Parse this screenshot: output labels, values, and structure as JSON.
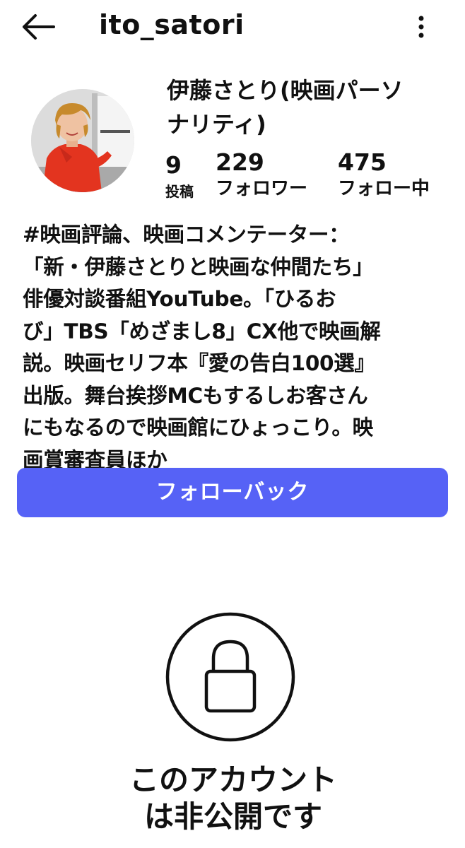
{
  "header": {
    "back_icon": "arrow-left-icon",
    "username": "ito_satori",
    "more_icon": "more-vertical-icon"
  },
  "profile": {
    "display_name": "伊藤さとり(映画パーソ\nナリティ)",
    "avatar_icon": "profile-photo"
  },
  "stats": {
    "posts": {
      "count": "9",
      "label": "投稿"
    },
    "followers": {
      "count": "229",
      "label": "フォロワー"
    },
    "following": {
      "count": "475",
      "label": "フォロー中"
    }
  },
  "bio": "#映画評論、映画コメンテーター：\n「新・伊藤さとりと映画な仲間たち」\n俳優対談番組YouTube。「ひるお\nび」TBS「めざまし8」CX他で映画解\n説。映画セリフ本『愛の告白100選』\n出版。舞台挨拶MCもするしお客さん\nにもなるので映画館にひょっこり。映\n画賞審査員ほか",
  "follow_button": {
    "label": "フォローバック",
    "color": "#5662f6"
  },
  "private": {
    "icon": "lock-icon",
    "message": "このアカウント\nは非公開です"
  }
}
